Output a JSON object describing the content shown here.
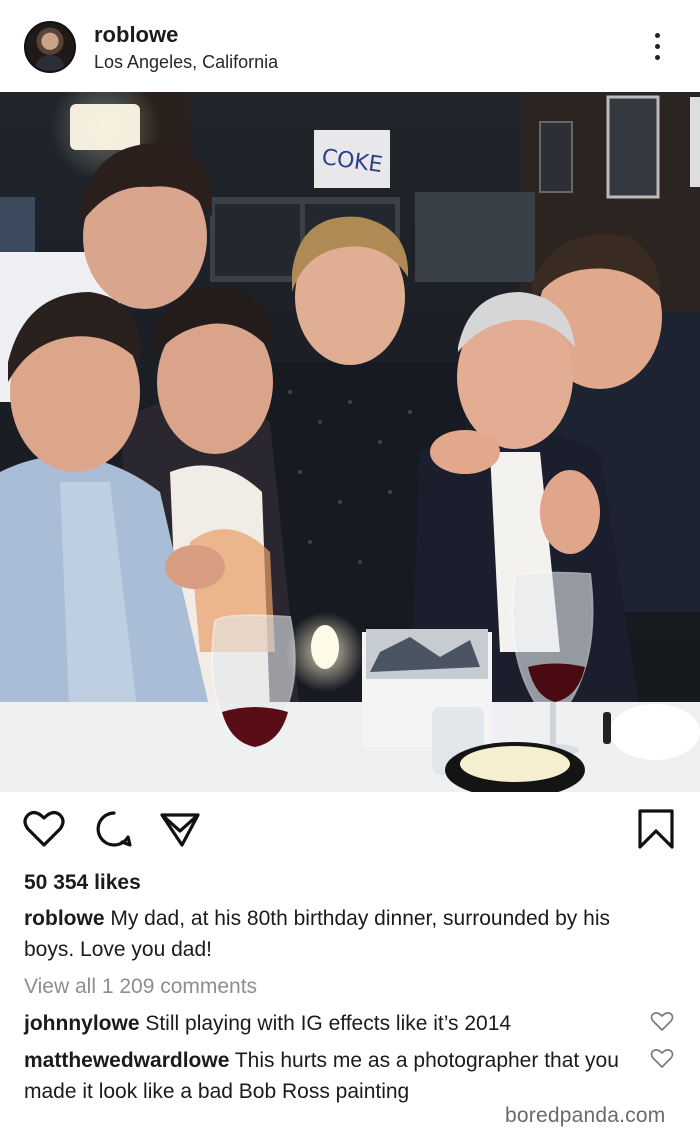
{
  "post": {
    "username": "roblowe",
    "location": "Los Angeles, California",
    "likes": "50 354 likes",
    "caption_user": "roblowe",
    "caption_text": "My dad, at his 80th birthday dinner, surrounded by his boys. Love you dad!",
    "view_all": "View all 1 209 comments"
  },
  "icons": {
    "options": "more-vertical-icon",
    "like": "heart-icon",
    "comment": "comment-icon",
    "share": "send-icon",
    "save": "bookmark-icon",
    "comment_like": "heart-outline-icon"
  },
  "comments": [
    {
      "user": "johnnylowe",
      "text": "Still playing with IG effects like it’s 2014"
    },
    {
      "user": "matthewedwardlowe",
      "text": "This hurts me as a photographer that you made it look like a bad Bob Ross painting"
    }
  ],
  "photo": {
    "wall_art_text": "COKE"
  },
  "watermark": "boredpanda.com",
  "colors": {
    "text": "#262626",
    "muted": "#8e8e8e",
    "background": "#ffffff"
  }
}
